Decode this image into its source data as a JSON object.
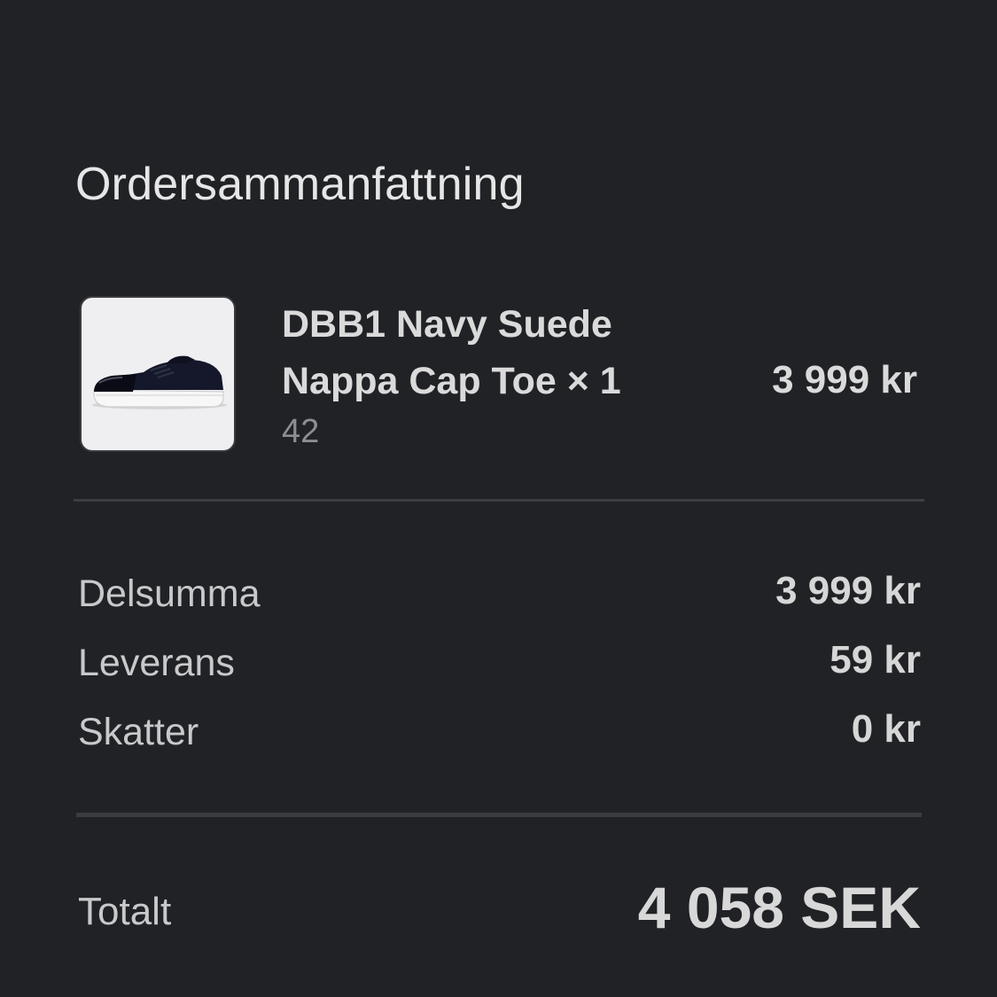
{
  "summary": {
    "title": "Ordersammanfattning"
  },
  "item": {
    "image_icon": "sneaker-product-image",
    "name": "DBB1 Navy Suede Nappa Cap Toe × 1",
    "variant": "42",
    "price": "3 999 kr"
  },
  "rows": [
    {
      "label": "Delsumma",
      "value": "3 999 kr"
    },
    {
      "label": "Leverans",
      "value": "59 kr"
    },
    {
      "label": "Skatter",
      "value": "0 kr"
    }
  ],
  "total": {
    "label": "Totalt",
    "value": "4 058 SEK"
  },
  "colors": {
    "background": "#202226",
    "divider": "#3c3e43",
    "text_primary": "#dadada",
    "text_muted": "#8d8e92"
  }
}
